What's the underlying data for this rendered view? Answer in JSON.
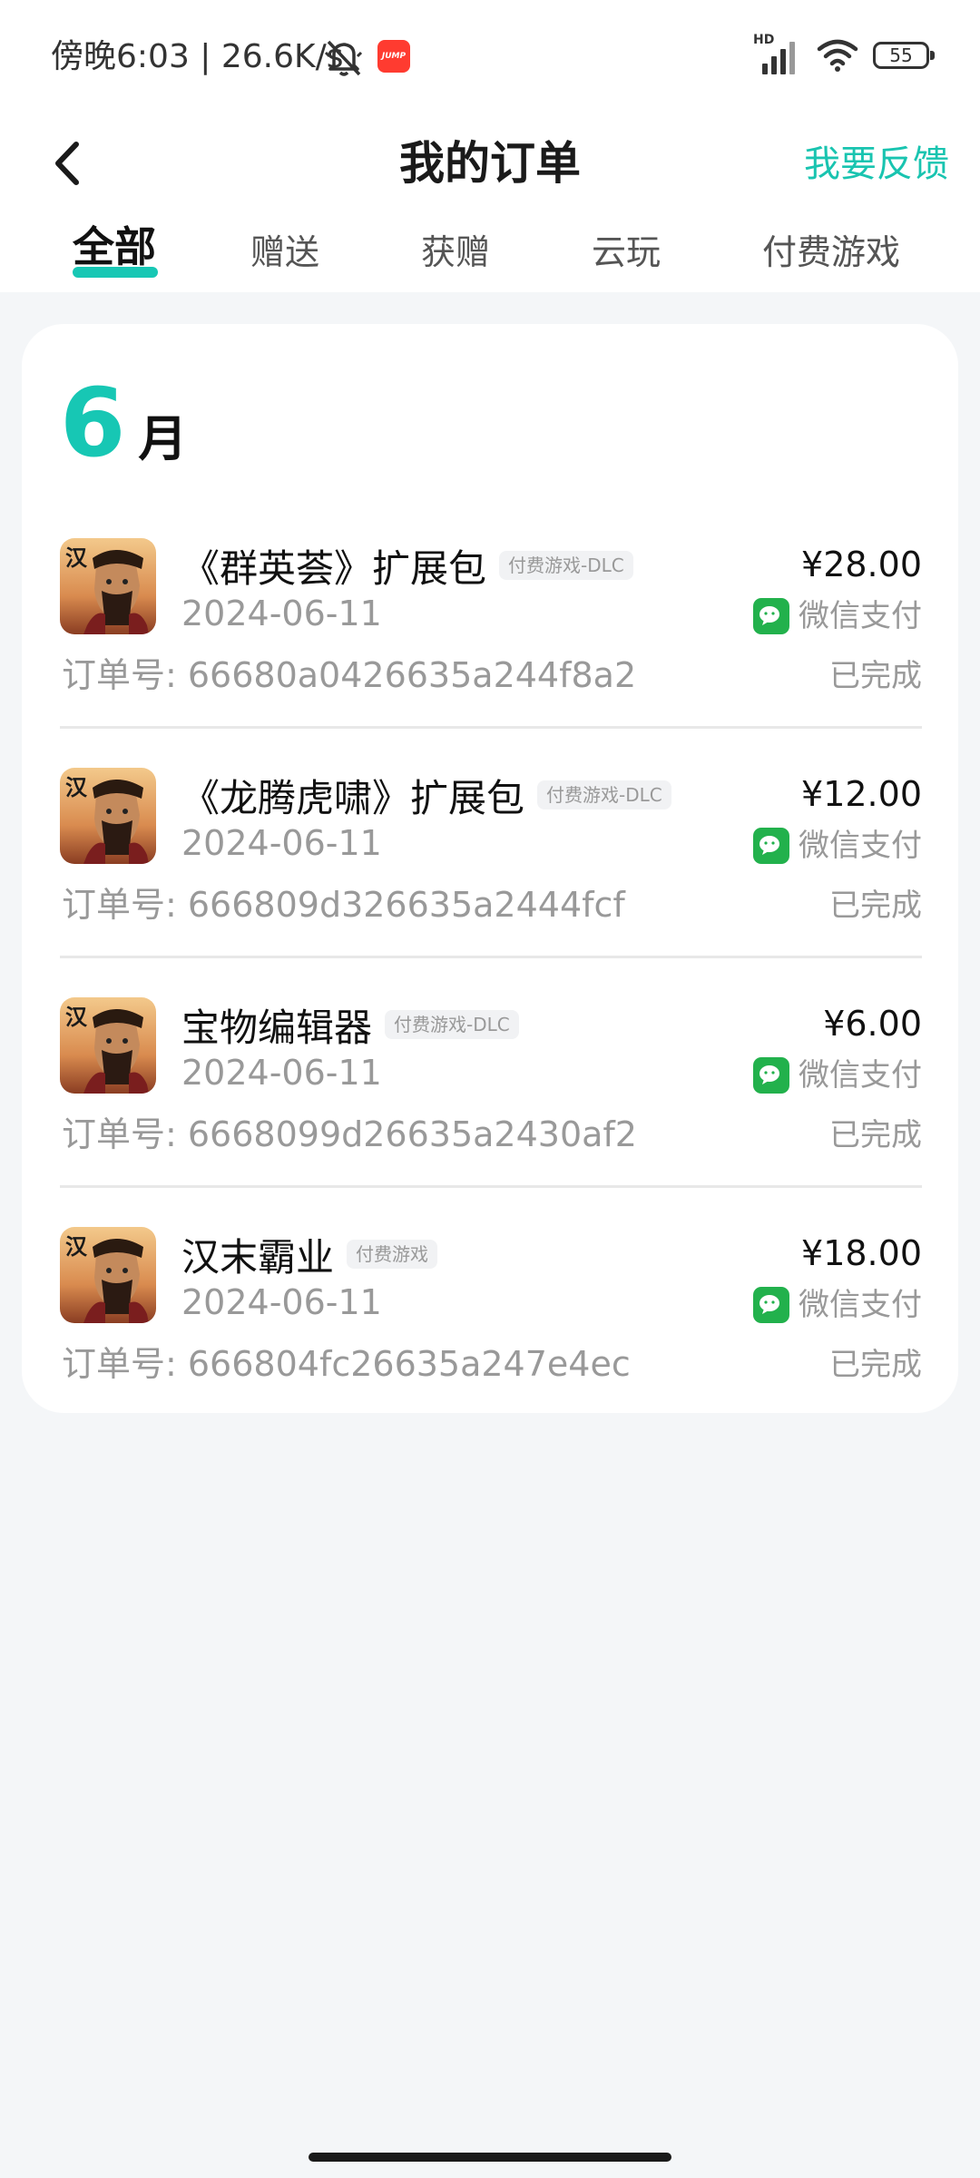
{
  "status_bar": {
    "time": "傍晚6:03 | 26.6K/s",
    "jump_badge": "JUMP",
    "network_label": "HD",
    "battery": "55"
  },
  "header": {
    "title": "我的订单",
    "feedback": "我要反馈"
  },
  "tabs": [
    {
      "label": "全部",
      "active": true
    },
    {
      "label": "赠送",
      "active": false
    },
    {
      "label": "获赠",
      "active": false
    },
    {
      "label": "云玩",
      "active": false
    },
    {
      "label": "付费游戏",
      "active": false
    }
  ],
  "month": {
    "number": "6",
    "unit": "月"
  },
  "orders": [
    {
      "name": "《群英荟》扩展包",
      "tag": "付费游戏-DLC",
      "date": "2024-06-11",
      "order_no": "订单号: 66680a0426635a244f8a2",
      "price": "¥28.00",
      "payment": "微信支付",
      "status": "已完成",
      "icon_char": "汉"
    },
    {
      "name": "《龙腾虎啸》扩展包",
      "tag": "付费游戏-DLC",
      "date": "2024-06-11",
      "order_no": "订单号: 666809d326635a2444fcf",
      "price": "¥12.00",
      "payment": "微信支付",
      "status": "已完成",
      "icon_char": "汉"
    },
    {
      "name": "宝物编辑器",
      "tag": "付费游戏-DLC",
      "date": "2024-06-11",
      "order_no": "订单号: 6668099d26635a2430af2",
      "price": "¥6.00",
      "payment": "微信支付",
      "status": "已完成",
      "icon_char": "汉"
    },
    {
      "name": "汉末霸业",
      "tag": "付费游戏",
      "date": "2024-06-11",
      "order_no": "订单号: 666804fc26635a247e4ec",
      "price": "¥18.00",
      "payment": "微信支付",
      "status": "已完成",
      "icon_char": "汉"
    }
  ],
  "colors": {
    "accent": "#17c7b4",
    "wechat": "#22b14c",
    "background": "#f4f6f8"
  }
}
